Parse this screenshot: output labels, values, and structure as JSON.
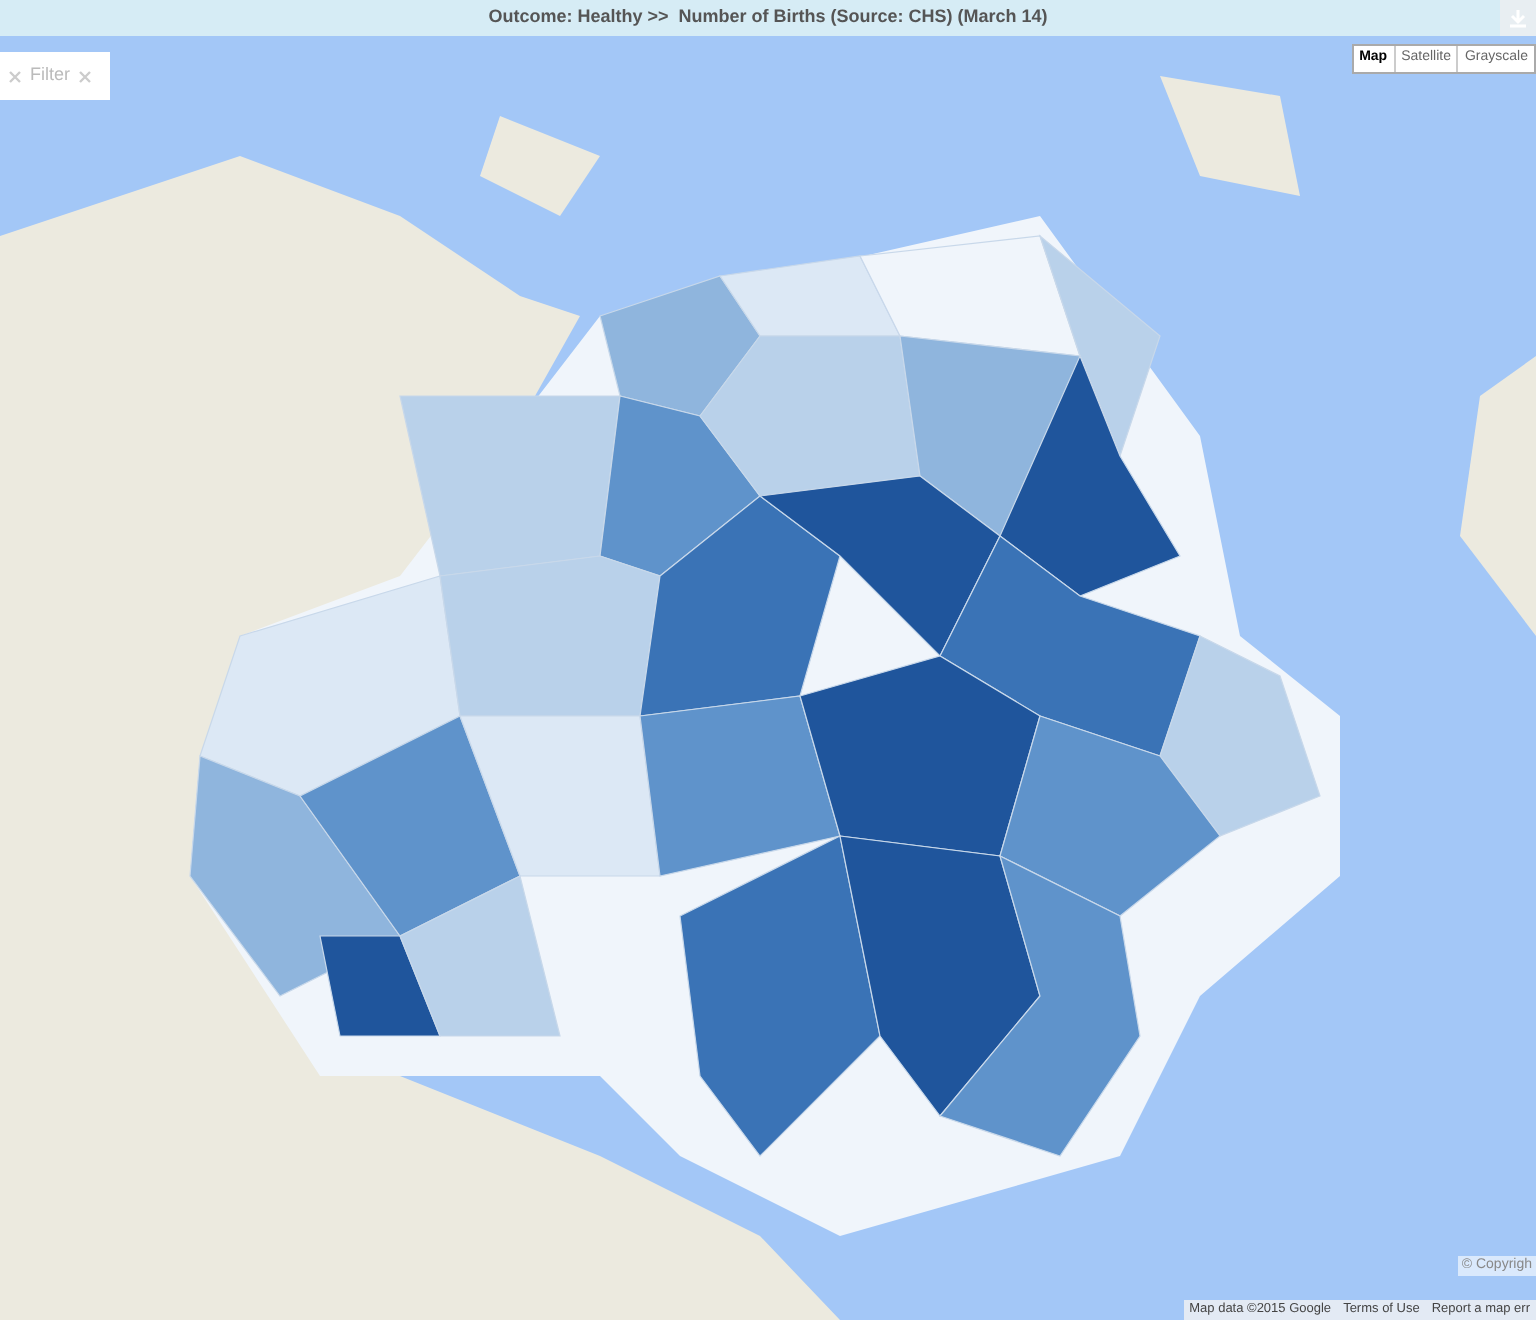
{
  "header": {
    "title": "Outcome: Healthy >>  Number of Births (Source: CHS) (March 14)"
  },
  "filter": {
    "label": "Filter"
  },
  "map_types": [
    {
      "label": "Map",
      "selected": true
    },
    {
      "label": "Satellite",
      "selected": false
    },
    {
      "label": "Grayscale",
      "selected": false
    }
  ],
  "attribution": {
    "copyright": "© Copyrigh",
    "map_data": "Map data ©2015 Google",
    "terms": "Terms of Use",
    "report": "Report a map err"
  }
}
